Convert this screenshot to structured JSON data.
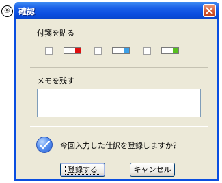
{
  "step_marker": "⑨",
  "dialog": {
    "title": "確認",
    "close_icon": "close-icon"
  },
  "sticky": {
    "label": "付箋を貼る",
    "options": [
      {
        "name": "red",
        "color": "#e01010",
        "checked": false
      },
      {
        "name": "blue",
        "color": "#3ba0e8",
        "checked": false
      },
      {
        "name": "green",
        "color": "#58c020",
        "checked": false
      }
    ]
  },
  "memo": {
    "label": "メモを残す",
    "value": ""
  },
  "question": {
    "icon": "question-icon",
    "text": "今回入力した仕訳を登録しますか？"
  },
  "buttons": {
    "register": "登録する",
    "cancel": "キャンセル"
  }
}
